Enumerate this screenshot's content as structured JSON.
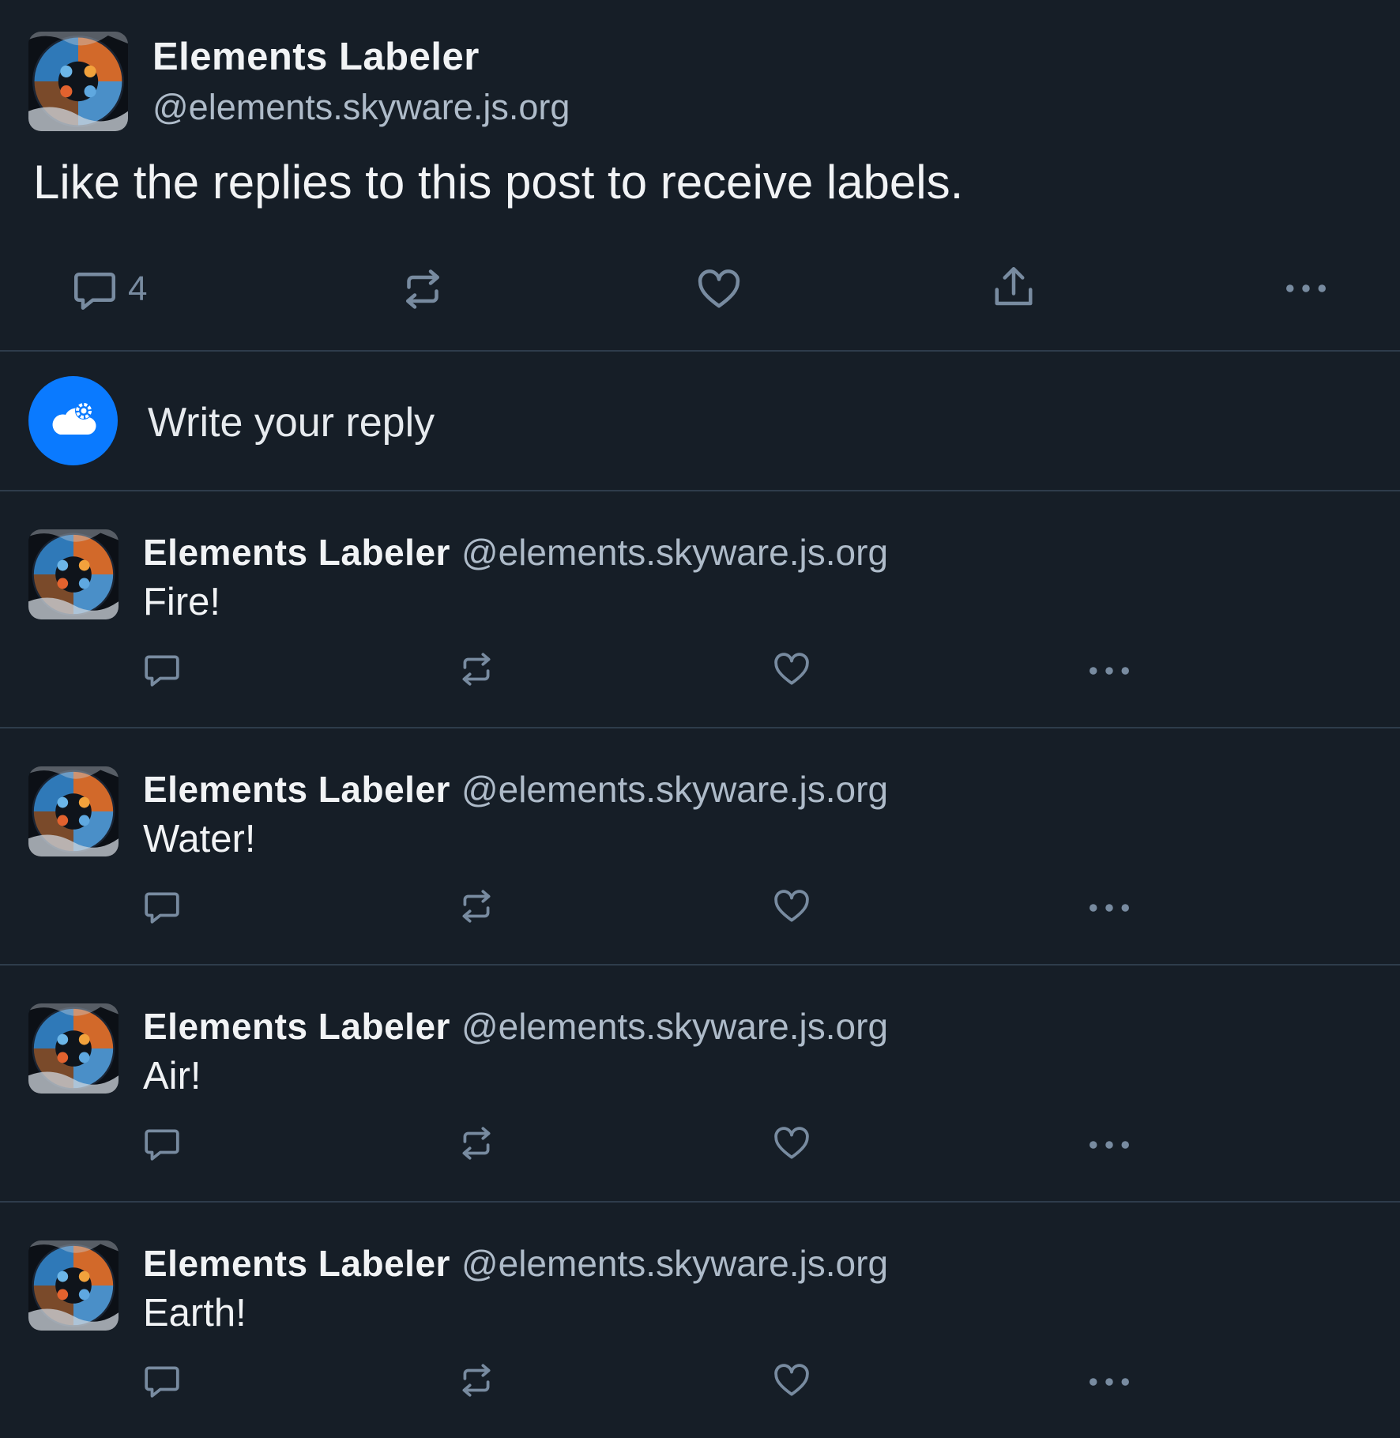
{
  "main_post": {
    "author_name": "Elements Labeler",
    "author_handle": "@elements.skyware.js.org",
    "text": "Like the replies to this post to receive labels.",
    "reply_count": "4",
    "actions": [
      "reply-icon",
      "repost-icon",
      "like-icon",
      "share-icon",
      "more-icon"
    ]
  },
  "composer": {
    "placeholder": "Write your reply",
    "avatar_icon": "cloud-gear-icon"
  },
  "replies": [
    {
      "author_name": "Elements Labeler",
      "author_handle": "@elements.skyware.js.org",
      "text": "Fire!"
    },
    {
      "author_name": "Elements Labeler",
      "author_handle": "@elements.skyware.js.org",
      "text": "Water!"
    },
    {
      "author_name": "Elements Labeler",
      "author_handle": "@elements.skyware.js.org",
      "text": "Air!"
    },
    {
      "author_name": "Elements Labeler",
      "author_handle": "@elements.skyware.js.org",
      "text": "Earth!"
    }
  ],
  "colors": {
    "background": "#161e27",
    "divider": "#2e3c4b",
    "icon": "#788ba0",
    "text_primary": "#f1f3f5",
    "text_secondary": "#aebbc9",
    "accent": "#0a7aff"
  }
}
